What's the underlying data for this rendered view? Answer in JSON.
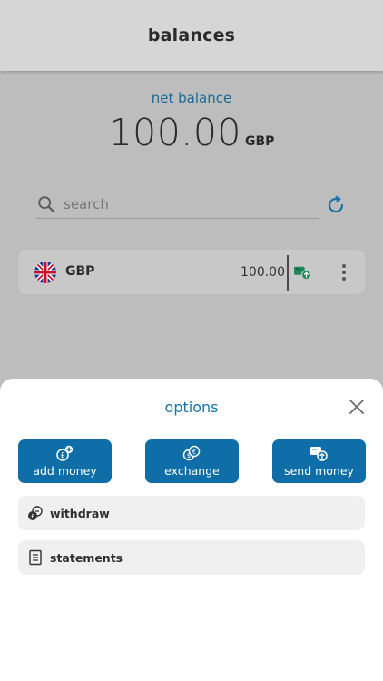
{
  "header": {
    "title": "balances"
  },
  "net_balance": {
    "label": "net balance",
    "amount": "100.00",
    "currency": "GBP"
  },
  "search": {
    "placeholder": "search"
  },
  "accounts": [
    {
      "flag": "uk-flag-icon",
      "code": "GBP",
      "amount": "100.00"
    }
  ],
  "options_sheet": {
    "title": "options",
    "actions": [
      {
        "label": "add money",
        "icon": "add-money-icon"
      },
      {
        "label": "exchange",
        "icon": "exchange-icon"
      },
      {
        "label": "send money",
        "icon": "send-money-icon"
      }
    ],
    "items": [
      {
        "label": "withdraw",
        "icon": "withdraw-icon"
      },
      {
        "label": "statements",
        "icon": "statements-icon"
      }
    ]
  },
  "colors": {
    "accent": "#0f6ea7",
    "accent_text": "#1a73a8",
    "positive": "#1a8a5a"
  }
}
